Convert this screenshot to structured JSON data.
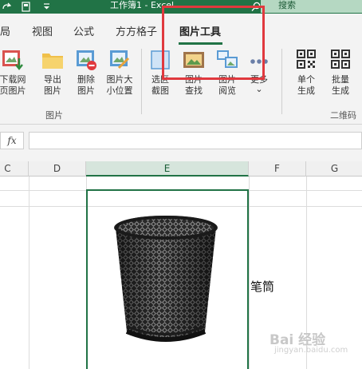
{
  "title_bar": {
    "window_title": "工作簿1 - Excel",
    "search_label": "搜索"
  },
  "tabs": [
    {
      "label": "局",
      "active": false
    },
    {
      "label": "视图",
      "active": false
    },
    {
      "label": "公式",
      "active": false
    },
    {
      "label": "方方格子",
      "active": false
    },
    {
      "label": "图片工具",
      "active": true
    }
  ],
  "ribbon": {
    "buttons": [
      {
        "label": "下载网\n页图片",
        "icon": "download-image-icon"
      },
      {
        "label": "导出\n图片",
        "icon": "export-folder-icon"
      },
      {
        "label": "删除\n图片",
        "icon": "delete-image-icon"
      },
      {
        "label": "图片大\n小位置",
        "icon": "resize-image-icon"
      },
      {
        "label": "选区\n截图",
        "icon": "screenshot-icon"
      },
      {
        "label": "图片\n查找",
        "icon": "find-image-icon"
      },
      {
        "label": "图片\n阅览",
        "icon": "browse-images-icon"
      },
      {
        "label": "更多",
        "icon": "more-dots-icon",
        "chevron": "⌄"
      },
      {
        "label": "单个\n生成",
        "icon": "qr-single-icon"
      },
      {
        "label": "批量\n生成",
        "icon": "qr-batch-icon"
      }
    ],
    "groups": [
      {
        "label": "图片"
      },
      {
        "label": "二维码"
      }
    ]
  },
  "formula_bar": {
    "fx_label": "fx",
    "value": ""
  },
  "columns": [
    {
      "label": "C",
      "selected": false
    },
    {
      "label": "D",
      "selected": false
    },
    {
      "label": "E",
      "selected": true
    },
    {
      "label": "F",
      "selected": false
    },
    {
      "label": "G",
      "selected": false
    }
  ],
  "sheet": {
    "f_cell_text": "笔筒",
    "picture": "mesh-pen-holder-picture"
  },
  "watermark": {
    "brand": "Bai 经验",
    "url": "jingyan.baidu.com"
  },
  "colors": {
    "excel_green": "#217346",
    "highlight_red": "#e0393e",
    "ribbon_bg": "#f3f3f3"
  }
}
